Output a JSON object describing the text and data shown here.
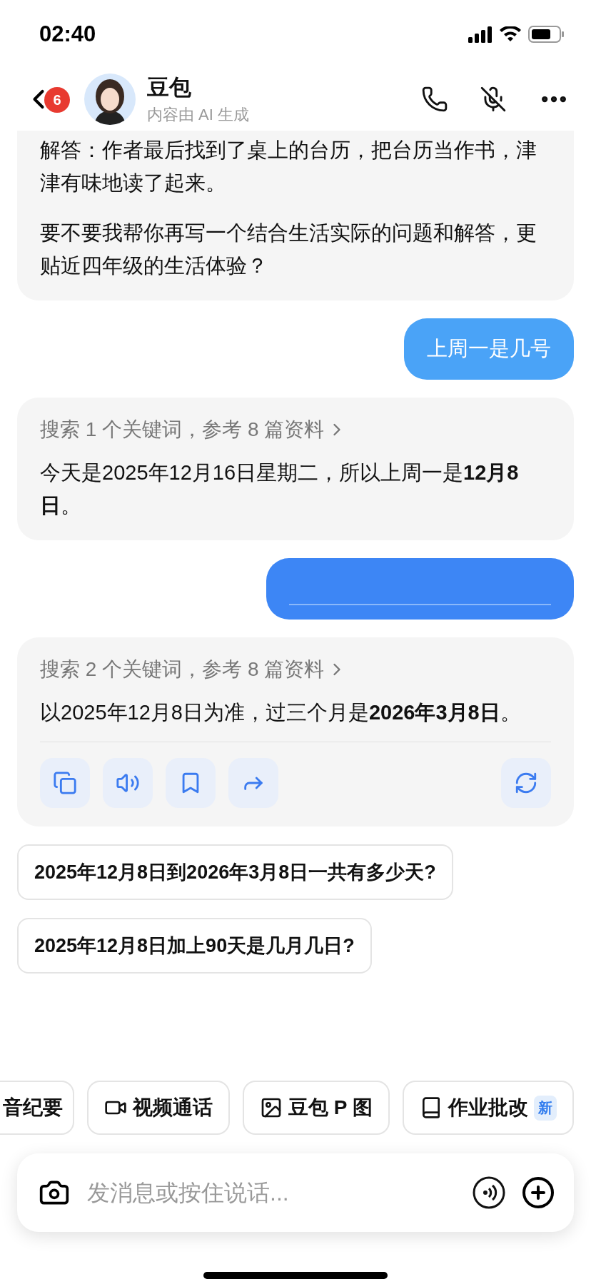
{
  "status_bar": {
    "time": "02:40"
  },
  "header": {
    "unread_badge": "6",
    "name": "豆包",
    "subtitle": "内容由 AI 生成"
  },
  "messages": [
    {
      "kind": "reply",
      "paragraphs": [
        "解答：作者最后找到了桌上的台历，把台历当作书，津津有味地读了起来。",
        "要不要我帮你再写一个结合生活实际的问题和解答，更贴近四年级的生活体验？"
      ]
    },
    {
      "kind": "user",
      "text": "上周一是几号"
    },
    {
      "kind": "search_reply",
      "search_summary": "搜索 1 个关键词，参考 8 篇资料",
      "paragraphs": [
        "今天是2025年12月16日星期二，所以上周一是**12月8日**。"
      ]
    },
    {
      "kind": "user_hidden"
    },
    {
      "kind": "latest_reply",
      "search_summary": "搜索 2 个关键词，参考 8 篇资料",
      "paragraphs": [
        "以2025年12月8日为准，过三个月是**2026年3月8日**。"
      ]
    }
  ],
  "suggestions": [
    "2025年12月8日到2026年3月8日一共有多少天?",
    "2025年12月8日加上90天是几月几日?"
  ],
  "quick_actions": [
    {
      "label": "音纪要"
    },
    {
      "label": "视频通话"
    },
    {
      "label": "豆包 P 图"
    },
    {
      "label": "作业批改",
      "badge": "新"
    }
  ],
  "input": {
    "placeholder": "发消息或按住说话..."
  }
}
